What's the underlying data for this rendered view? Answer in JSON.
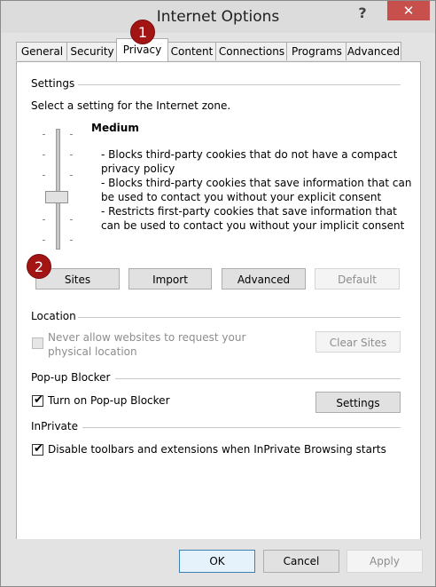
{
  "window": {
    "title": "Internet Options",
    "help_icon": "?",
    "close_icon": "✕"
  },
  "tabs": [
    {
      "label": "General"
    },
    {
      "label": "Security"
    },
    {
      "label": "Privacy"
    },
    {
      "label": "Content"
    },
    {
      "label": "Connections"
    },
    {
      "label": "Programs"
    },
    {
      "label": "Advanced"
    }
  ],
  "badges": {
    "one": "1",
    "two": "2"
  },
  "settings": {
    "title": "Settings",
    "instruction": "Select a setting for the Internet zone.",
    "level": "Medium",
    "desc": [
      "- Blocks third-party cookies that do not have a compact",
      "privacy policy",
      "- Blocks third-party cookies that save information that can",
      "be used to contact you without your explicit consent",
      "- Restricts first-party cookies that save information that",
      "can be used to contact you without your implicit consent"
    ],
    "buttons": {
      "sites": "Sites",
      "import": "Import",
      "advanced": "Advanced",
      "default": "Default"
    }
  },
  "location": {
    "title": "Location",
    "checkbox_label_line1": "Never allow websites to request your",
    "checkbox_label_line2": "physical location",
    "clear_sites": "Clear Sites"
  },
  "popup": {
    "title": "Pop-up Blocker",
    "checkbox_label": "Turn on Pop-up Blocker",
    "settings_button": "Settings"
  },
  "inprivate": {
    "title": "InPrivate",
    "checkbox_label": "Disable toolbars and extensions when InPrivate Browsing starts"
  },
  "footer": {
    "ok": "OK",
    "cancel": "Cancel",
    "apply": "Apply"
  }
}
